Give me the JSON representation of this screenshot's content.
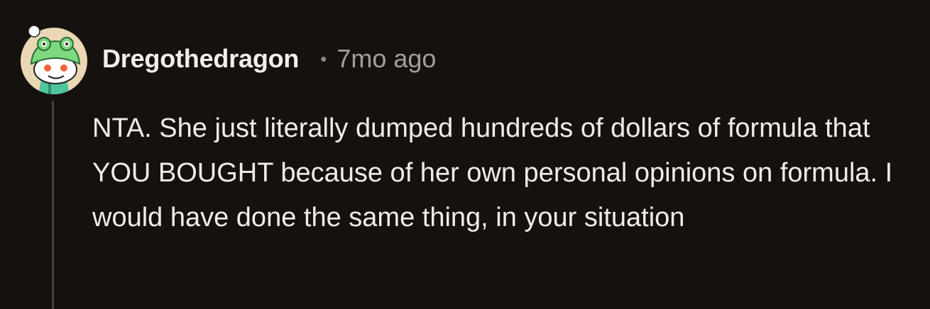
{
  "comment": {
    "username": "Dregothedragon",
    "separator": "•",
    "timestamp": "7mo ago",
    "body": "NTA. She just literally dumped hundreds of dollars of formula that YOU BOUGHT because of her own personal opinions on formula. I would have done the same thing, in your situation"
  },
  "colors": {
    "background": "#15110f",
    "username": "#f2efea",
    "timestamp": "#a49f98",
    "body_text": "#f0ede8",
    "thread_line": "#45413e",
    "avatar_bg": "#ead7b3",
    "avatar_hat": "#7dd87f"
  },
  "icons": {
    "avatar": "snoo-frog-hat-avatar"
  }
}
